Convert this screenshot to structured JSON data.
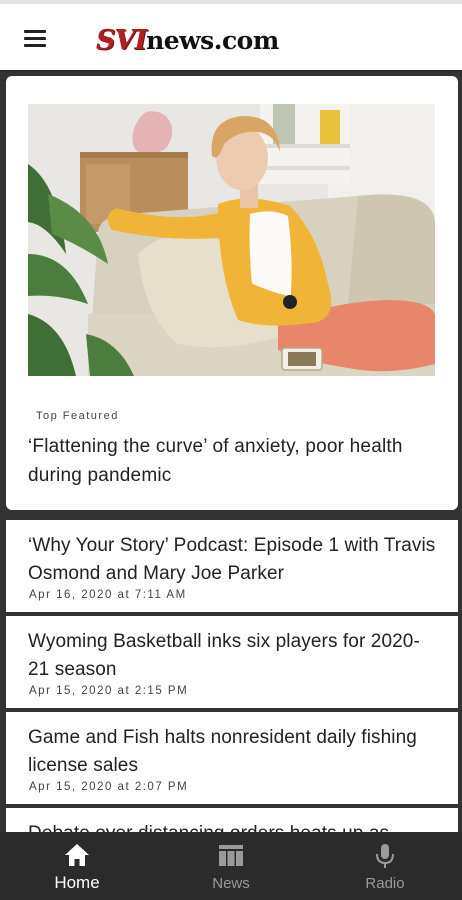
{
  "header": {
    "logo_part1": "SVI",
    "logo_part2": "news.com",
    "brand_color": "#b02020"
  },
  "featured": {
    "category": "Top Featured",
    "title": "‘Flattening the curve’ of anxiety, poor health during pandemic"
  },
  "articles": [
    {
      "title": "‘Why Your Story’ Podcast: Episode 1 with Travis Osmond and Mary Joe Parker",
      "date": "Apr 16, 2020 at 7:11 AM"
    },
    {
      "title": "Wyoming Basketball inks six players for 2020-21 season",
      "date": "Apr 15, 2020 at 2:15 PM"
    },
    {
      "title": "Game and Fish halts nonresident daily fishing license sales",
      "date": "Apr 15, 2020 at 2:07 PM"
    },
    {
      "title": "Debate over distancing orders heats up as",
      "date": ""
    }
  ],
  "nav": {
    "items": [
      {
        "label": "Home",
        "icon": "home-icon",
        "active": true
      },
      {
        "label": "News",
        "icon": "news-icon",
        "active": false
      },
      {
        "label": "Radio",
        "icon": "microphone-icon",
        "active": false
      }
    ]
  }
}
